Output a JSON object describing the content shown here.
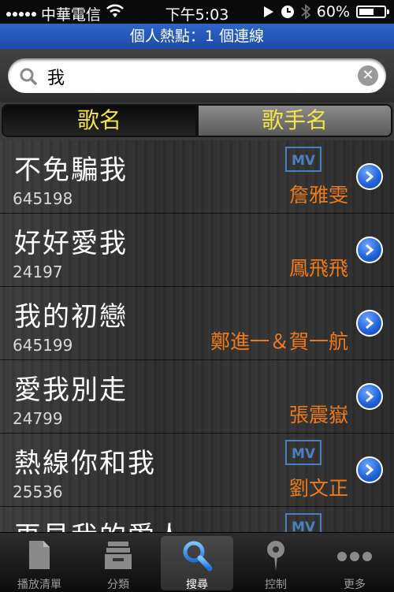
{
  "status": {
    "carrier": "中華電信",
    "time": "下午5:03",
    "battery": "60%",
    "battery_level": 0.6
  },
  "hotspot": {
    "text": "個人熱點：1 個連線"
  },
  "search": {
    "value": "我"
  },
  "segments": {
    "song": "歌名",
    "artist": "歌手名"
  },
  "songs": [
    {
      "title": "不免騙我",
      "code": "645198",
      "artist": "詹雅雯",
      "mv": "MV"
    },
    {
      "title": "好好愛我",
      "code": "24197",
      "artist": "鳳飛飛",
      "mv": ""
    },
    {
      "title": "我的初戀",
      "code": "645199",
      "artist": "鄭進一＆賀一航",
      "mv": ""
    },
    {
      "title": "愛我別走",
      "code": "24799",
      "artist": "張震嶽",
      "mv": ""
    },
    {
      "title": "熱線你和我",
      "code": "25536",
      "artist": "劉文正",
      "mv": "MV"
    },
    {
      "title": "再見我的愛人",
      "code": "",
      "artist": "",
      "mv": "MV"
    }
  ],
  "tabs": {
    "playlist": "播放清單",
    "category": "分類",
    "search": "搜尋",
    "control": "控制",
    "more": "更多"
  },
  "colors": {
    "accent_yellow": "#f0e64a",
    "artist_orange": "#f07a1a",
    "hotspot_blue": "#1b4aa8"
  }
}
